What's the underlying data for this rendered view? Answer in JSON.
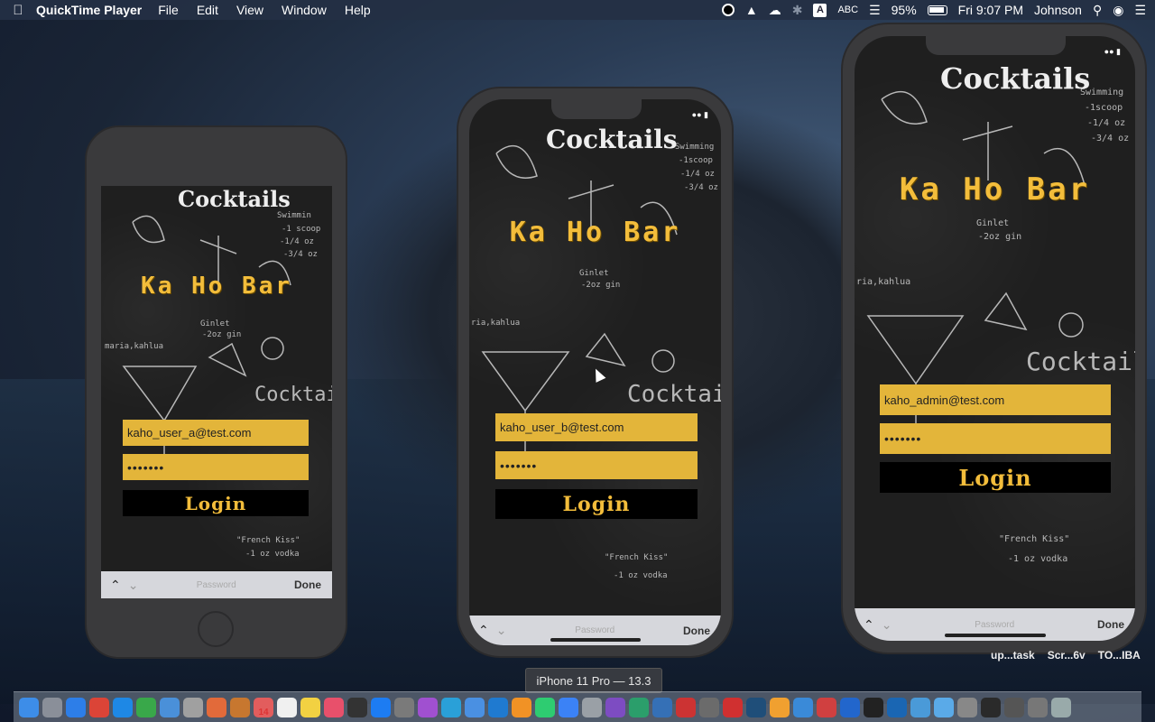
{
  "menubar": {
    "app_name": "QuickTime Player",
    "menus": [
      "File",
      "Edit",
      "View",
      "Window",
      "Help"
    ],
    "input_source": "ABC",
    "battery": "95%",
    "clock": "Fri 9:07 PM",
    "user": "Johnson",
    "input_letter": "A"
  },
  "phones": [
    {
      "model": "iPhone 8",
      "heading": "Cocktails",
      "brand": "Ka Ho Bar",
      "email": "kaho_user_a@test.com",
      "password_mask": "•••••••",
      "login_label": "Login",
      "kb_placeholder": "Password",
      "kb_done": "Done"
    },
    {
      "model": "iPhone 11 Pro",
      "heading": "Cocktails",
      "brand": "Ka Ho Bar",
      "email": "kaho_user_b@test.com",
      "password_mask": "•••••••",
      "login_label": "Login",
      "kb_placeholder": "Password",
      "kb_done": "Done"
    },
    {
      "model": "iPhone 11 Pro Max",
      "heading": "Cocktails",
      "brand": "Ka Ho Bar",
      "email": "kaho_admin@test.com",
      "password_mask": "•••••••",
      "login_label": "Login",
      "kb_placeholder": "Password",
      "kb_done": "Done"
    }
  ],
  "tooltip": "iPhone 11 Pro — 13.3",
  "desktop_labels": [
    "up...task",
    "Scr...6v",
    "TO...IBA"
  ],
  "dock": {
    "calendar_day": "14",
    "icon_colors": [
      "#3d8de8",
      "#8a8f99",
      "#2d7ee8",
      "#db4437",
      "#1e88e5",
      "#39a84a",
      "#4a90d9",
      "#a0a0a0",
      "#e26a3a",
      "#c7772f",
      "#e25d5d",
      "#f0f0f0",
      "#f2d142",
      "#e8506b",
      "#333333",
      "#1d7cf2",
      "#7a7a7a",
      "#a050d0",
      "#2aa0d8",
      "#4a90e2",
      "#1f7ad0",
      "#f19225",
      "#2ecc71",
      "#3b82f6",
      "#9aa0a6",
      "#7d4cc2",
      "#2b9e6b",
      "#3570b6",
      "#cc3333",
      "#6b6b6b",
      "#d03030",
      "#1f4e79",
      "#f0a030",
      "#3a8ad8",
      "#d04040",
      "#2266cc",
      "#222222",
      "#1a66b3",
      "#4a9ad8",
      "#5aaae8",
      "#888888",
      "#2a2a2a",
      "#555555",
      "#777777",
      "#9aa"
    ]
  }
}
